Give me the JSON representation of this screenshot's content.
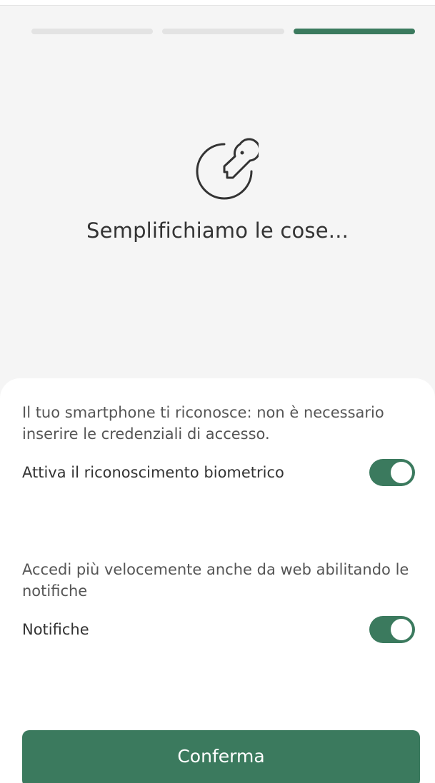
{
  "progress": {
    "steps_total": 3,
    "current_step": 3
  },
  "hero": {
    "icon": "key-circle-icon",
    "title": "Semplifichiamo le cose..."
  },
  "biometric": {
    "description": "Il tuo smartphone ti riconosce: non è necessario inserire le credenziali di accesso.",
    "label": "Attiva il riconoscimento biometrico",
    "enabled": true
  },
  "notifications": {
    "description": "Accedi più velocemente anche da web abilitando le notifiche",
    "label": "Notifiche",
    "enabled": true
  },
  "actions": {
    "confirm_label": "Conferma"
  },
  "colors": {
    "accent": "#3b7a5e",
    "background": "#f5f5f5",
    "sheet": "#ffffff",
    "text": "#333333",
    "inactive_progress": "#e3e3e3"
  }
}
